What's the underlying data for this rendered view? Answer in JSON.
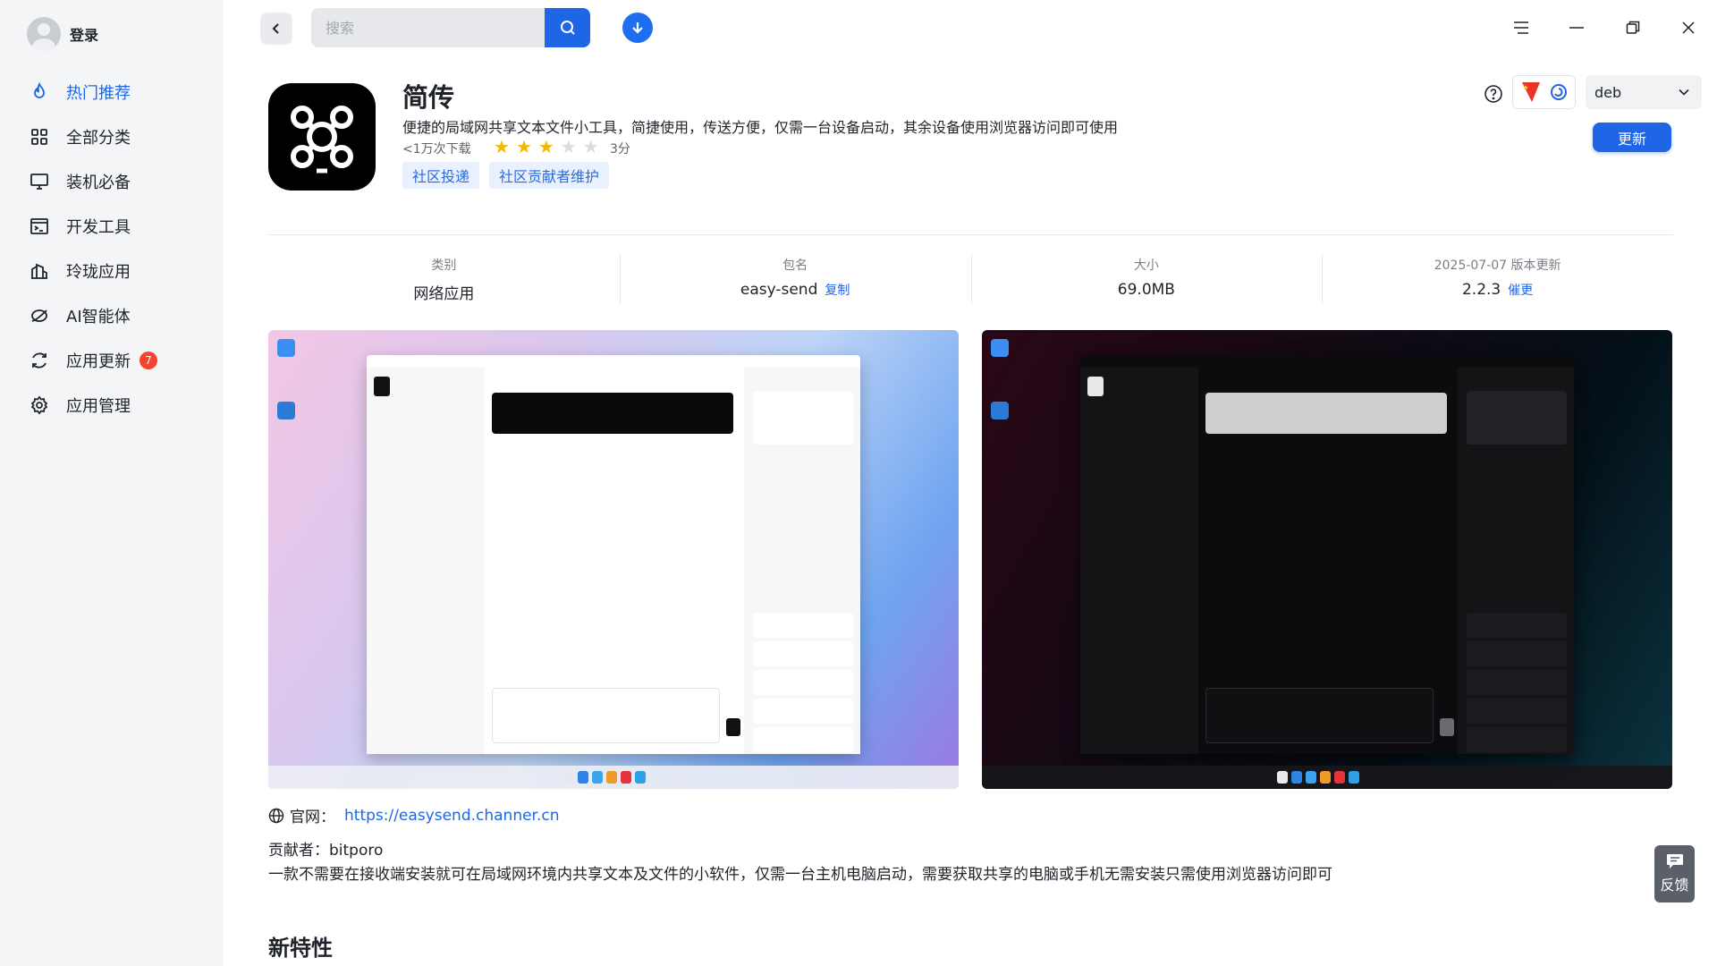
{
  "sidebar": {
    "login_label": "登录",
    "items": [
      {
        "label": "热门推荐",
        "icon": "flame-icon"
      },
      {
        "label": "全部分类",
        "icon": "grid-icon"
      },
      {
        "label": "装机必备",
        "icon": "monitor-icon"
      },
      {
        "label": "开发工具",
        "icon": "terminal-icon"
      },
      {
        "label": "玲珑应用",
        "icon": "building-icon"
      },
      {
        "label": "AI智能体",
        "icon": "ai-icon"
      },
      {
        "label": "应用更新",
        "icon": "refresh-icon",
        "badge": "7"
      },
      {
        "label": "应用管理",
        "icon": "gear-icon"
      }
    ],
    "active_index": 0
  },
  "topbar": {
    "search_placeholder": "搜索",
    "window_controls": [
      "menu-icon",
      "minimize-icon",
      "restore-icon",
      "close-icon"
    ]
  },
  "app": {
    "name": "简传",
    "description": "便捷的局域网共享文本文件小工具，简捷使用，传送方便，仅需一台设备启动，其余设备使用浏览器访问即可使用",
    "downloads": "<1万次下载",
    "rating": 3,
    "score": "3分",
    "tags": [
      "社区投递",
      "社区贡献者维护"
    ],
    "format": "deb",
    "update_label": "更新"
  },
  "info": {
    "category_label": "类别",
    "category_value": "网络应用",
    "package_label": "包名",
    "package_value": "easy-send",
    "copy_label": "复制",
    "size_label": "大小",
    "size_value": "69.0MB",
    "version_label": "2025-07-07 版本更新",
    "version_value": "2.2.3",
    "urge_label": "催更"
  },
  "details": {
    "website_label": "官网：",
    "website_url": "https://easysend.channer.cn",
    "contributor": "贡献者：bitporo",
    "long_description": "一款不需要在接收端安装就可在局域网环境内共享文本及文件的小软件，仅需一台主机电脑启动，需要获取共享的电脑或手机无需安装只需使用浏览器访问即可",
    "new_features_title": "新特性"
  },
  "feedback_label": "反馈",
  "colors": {
    "accent": "#1e66e6",
    "badge": "#f5432e",
    "star": "#f5b800"
  }
}
